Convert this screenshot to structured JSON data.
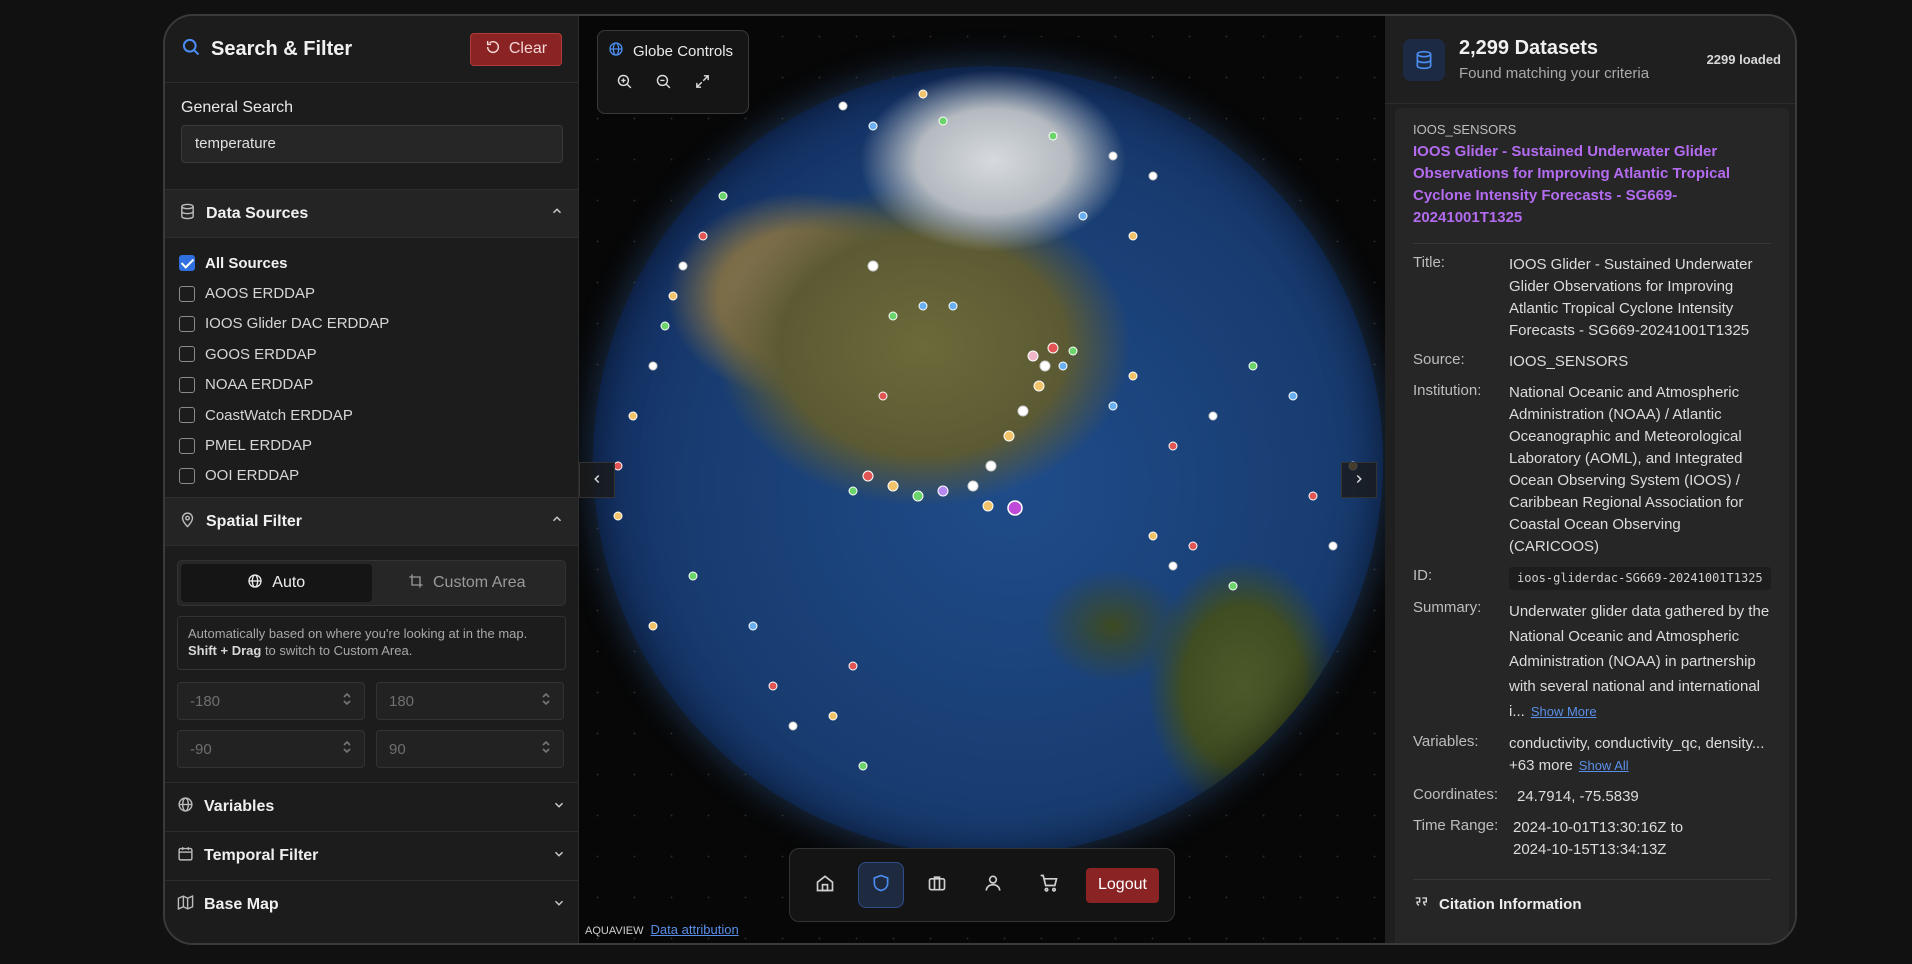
{
  "left": {
    "title": "Search & Filter",
    "clear_label": "Clear",
    "general_search_label": "General Search",
    "general_search_value": "temperature",
    "data_sources_title": "Data Sources",
    "sources": [
      {
        "label": "All Sources",
        "checked": true
      },
      {
        "label": "AOOS ERDDAP",
        "checked": false
      },
      {
        "label": "IOOS Glider DAC ERDDAP",
        "checked": false
      },
      {
        "label": "GOOS ERDDAP",
        "checked": false
      },
      {
        "label": "NOAA ERDDAP",
        "checked": false
      },
      {
        "label": "CoastWatch ERDDAP",
        "checked": false
      },
      {
        "label": "PMEL ERDDAP",
        "checked": false
      },
      {
        "label": "OOI ERDDAP",
        "checked": false
      }
    ],
    "spatial_title": "Spatial Filter",
    "mode_auto": "Auto",
    "mode_custom": "Custom Area",
    "note_text": "Automatically based on where you're looking at in the map.",
    "note_bold": "Shift + Drag",
    "note_tail": " to switch to Custom Area.",
    "min_lon": "-180",
    "max_lon": "180",
    "min_lat": "-90",
    "max_lat": "90",
    "variables_title": "Variables",
    "temporal_title": "Temporal Filter",
    "basemap_title": "Base Map"
  },
  "map": {
    "globe_controls_title": "Globe Controls",
    "logout_label": "Logout",
    "attribution_brand": "AQUAVIEW",
    "attribution_link": "Data attribution"
  },
  "right": {
    "count_title": "2,299 Datasets",
    "count_subtitle": "Found matching your criteria",
    "loaded": "2299 loaded",
    "source_tag": "IOOS_SENSORS",
    "dataset_title": "IOOS Glider - Sustained Underwater Glider Observations for Improving Atlantic Tropical Cyclone Intensity Forecasts - SG669-20241001T1325",
    "title_key": "Title:",
    "title_value": "IOOS Glider - Sustained Underwater Glider Observations for Improving Atlantic Tropical Cyclone Intensity Forecasts - SG669-20241001T1325",
    "source_key": "Source:",
    "source_value": "IOOS_SENSORS",
    "institution_key": "Institution:",
    "institution_value": "National Oceanic and Atmospheric Administration (NOAA) / Atlantic Oceanographic and Meteorological Laboratory (AOML), and Integrated Ocean Observing System (IOOS) / Caribbean Regional Association for Coastal Ocean Observing (CARICOOS)",
    "id_key": "ID:",
    "id_value": "ioos-gliderdac-SG669-20241001T1325",
    "summary_key": "Summary:",
    "summary_value": "Underwater glider data gathered by the National Oceanic and Atmospheric Administration (NOAA) in partnership with several national and international i...",
    "show_more": "Show More",
    "variables_key": "Variables:",
    "variables_value": "conductivity, conductivity_qc, density... +63 more",
    "show_all": "Show All",
    "coords_key": "Coordinates:",
    "coords_value": "24.7914, -75.5839",
    "time_key": "Time Range:",
    "time_value": "2024-10-01T13:30:16Z to 2024-10-15T13:34:13Z",
    "citation_title": "Citation Information"
  },
  "colors": {
    "accent": "#2f6fe0",
    "danger": "#8a2424",
    "title_purple": "#b36bf0"
  }
}
